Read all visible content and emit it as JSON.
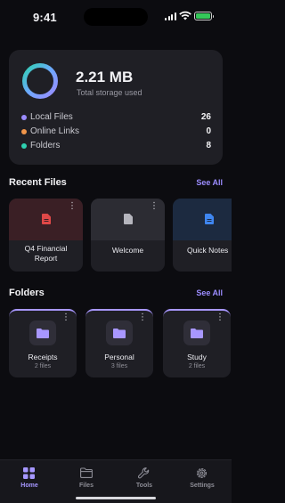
{
  "status_bar": {
    "time": "9:41"
  },
  "storage": {
    "value": "2.21 MB",
    "label": "Total storage used",
    "rows": [
      {
        "label": "Local Files",
        "value": "26",
        "color": "#9b8cff"
      },
      {
        "label": "Online Links",
        "value": "0",
        "color": "#f0954a"
      },
      {
        "label": "Folders",
        "value": "8",
        "color": "#2ed0b0"
      }
    ]
  },
  "recent": {
    "title": "Recent Files",
    "see_all": "See All",
    "files": [
      {
        "name": "Q4 Financial Report",
        "icon": "pdf-file-icon",
        "color": "#e04848"
      },
      {
        "name": "Welcome",
        "icon": "text-file-icon",
        "color": "#b5b5bd"
      },
      {
        "name": "Quick Notes",
        "icon": "doc-file-icon",
        "color": "#3f86f0"
      }
    ]
  },
  "folders": {
    "title": "Folders",
    "see_all": "See All",
    "items": [
      {
        "name": "Receipts",
        "count": "2 files"
      },
      {
        "name": "Personal",
        "count": "3 files"
      },
      {
        "name": "Study",
        "count": "2 files"
      }
    ]
  },
  "tabs": [
    {
      "label": "Home",
      "icon": "grid-icon",
      "active": true
    },
    {
      "label": "Files",
      "icon": "folder-icon",
      "active": false
    },
    {
      "label": "Tools",
      "icon": "wrench-icon",
      "active": false
    },
    {
      "label": "Settings",
      "icon": "gear-icon",
      "active": false
    }
  ],
  "colors": {
    "accent": "#9b8cff",
    "background": "#0c0c10",
    "card": "#1f1f25"
  }
}
